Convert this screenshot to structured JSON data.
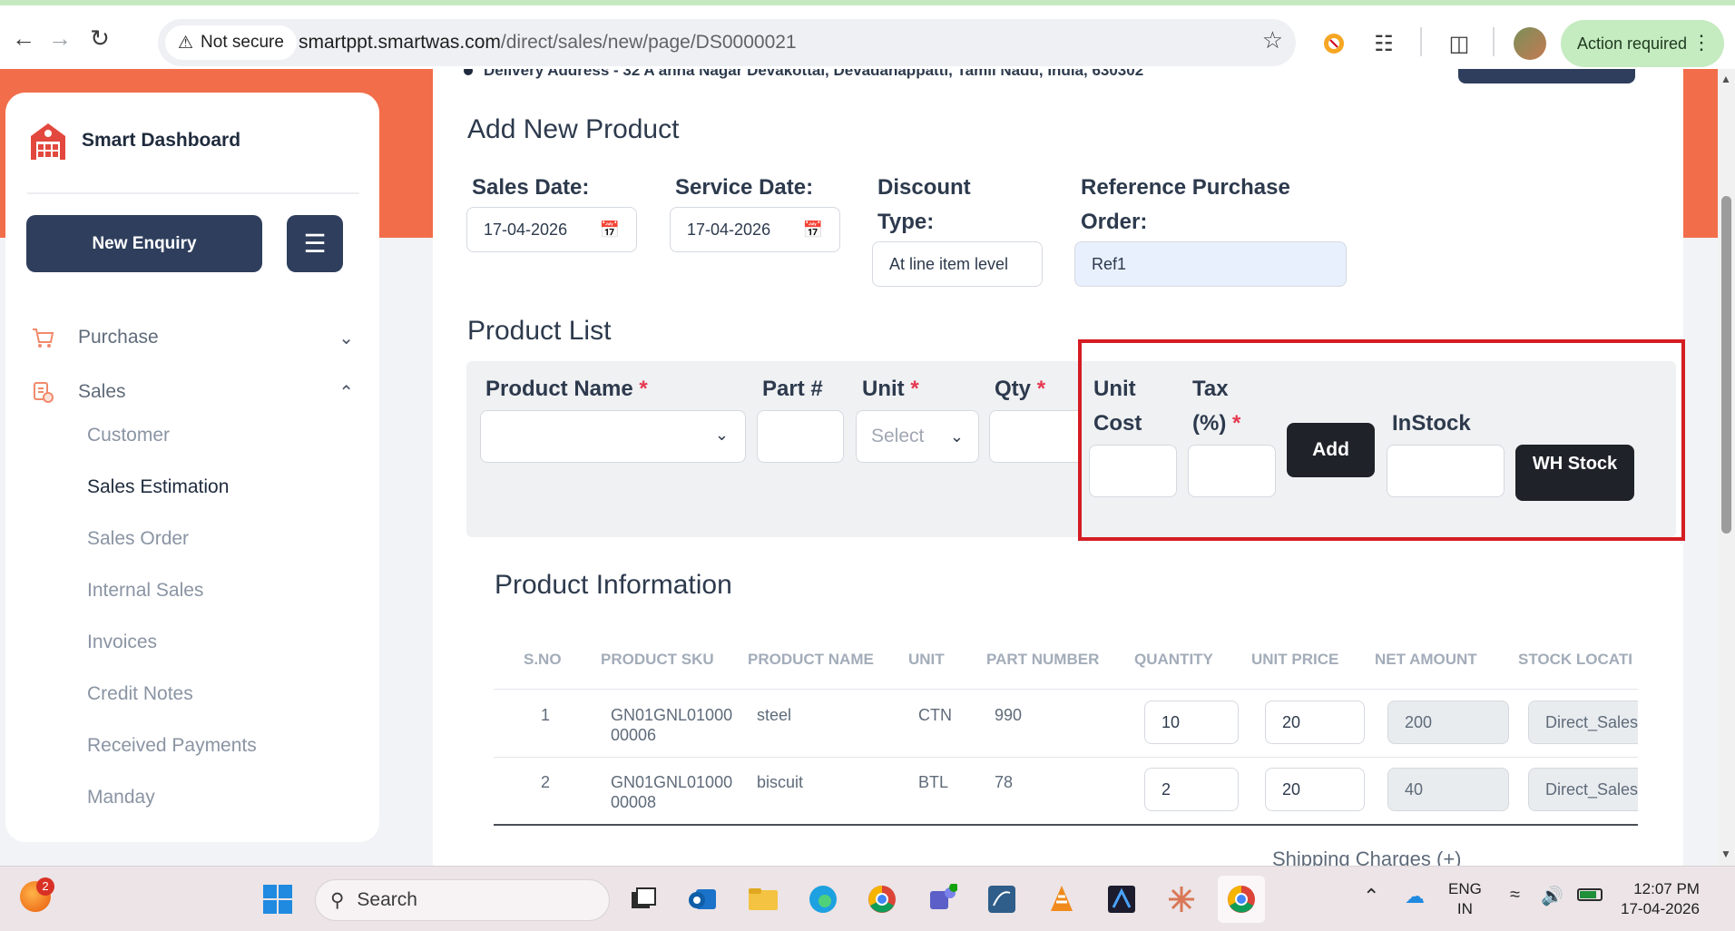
{
  "browser": {
    "security_label": "Not secure",
    "url_host": "smartppt.smartwas.com",
    "url_path": "/direct/sales/new/page/DS0000021",
    "action_required": "Action required"
  },
  "sidebar": {
    "brand": "Smart Dashboard",
    "new_enquiry": "New Enquiry",
    "sections": [
      {
        "label": "Purchase"
      },
      {
        "label": "Sales"
      }
    ],
    "sales_items": [
      {
        "label": "Customer"
      },
      {
        "label": "Sales Estimation"
      },
      {
        "label": "Sales Order"
      },
      {
        "label": "Internal Sales"
      },
      {
        "label": "Invoices"
      },
      {
        "label": "Credit Notes"
      },
      {
        "label": "Received Payments"
      },
      {
        "label": "Manday"
      }
    ]
  },
  "main": {
    "delivery_address": "Delivery Address - 32 A anna Nagar Devakottai, Devadanappatti, Tamil Nadu, India, 630302",
    "add_new_title": "Add New Product",
    "form": {
      "sales_date_label": "Sales Date:",
      "sales_date_value": "17-04-2026",
      "service_date_label": "Service Date:",
      "service_date_value": "17-04-2026",
      "discount_type_label_1": "Discount",
      "discount_type_label_2": "Type:",
      "discount_type_value": "At line item level",
      "ref_po_label_1": "Reference Purchase",
      "ref_po_label_2": "Order:",
      "ref_po_value": "Ref1"
    },
    "product_list_title": "Product List",
    "product_entry": {
      "product_name_label": "Product Name",
      "part_label": "Part #",
      "unit_label": "Unit",
      "unit_placeholder": "Select",
      "qty_label": "Qty",
      "unit_cost_label_1": "Unit",
      "unit_cost_label_2": "Cost",
      "tax_label_1": "Tax",
      "tax_label_2": "(%)",
      "add_button": "Add",
      "instock_label": "InStock",
      "wh_stock_button": "WH Stock",
      "required_mark": "*"
    },
    "product_info_title": "Product Information",
    "table": {
      "headers": [
        "S.NO",
        "PRODUCT SKU",
        "PRODUCT NAME",
        "UNIT",
        "PART NUMBER",
        "QUANTITY",
        "UNIT PRICE",
        "NET AMOUNT",
        "STOCK LOCATI"
      ],
      "rows": [
        {
          "sno": "1",
          "sku_1": "GN01GNL01000",
          "sku_2": "00006",
          "name": "steel",
          "unit": "CTN",
          "part": "990",
          "qty": "10",
          "price": "20",
          "net": "200",
          "stock": "Direct_Sales"
        },
        {
          "sno": "2",
          "sku_1": "GN01GNL01000",
          "sku_2": "00008",
          "name": "biscuit",
          "unit": "BTL",
          "part": "78",
          "qty": "2",
          "price": "20",
          "net": "40",
          "stock": "Direct_Sales"
        }
      ]
    },
    "shipping_label": "Shipping Charges (+)"
  },
  "taskbar": {
    "search": "Search",
    "notification_count": "2",
    "lang_1": "ENG",
    "lang_2": "IN",
    "time": "12:07 PM",
    "date": "17-04-2026"
  },
  "colors": {
    "accent_orange": "#f26d4a",
    "navy": "#2e3e5c",
    "highlight_red": "#d41c22",
    "required_red": "#e53950"
  }
}
